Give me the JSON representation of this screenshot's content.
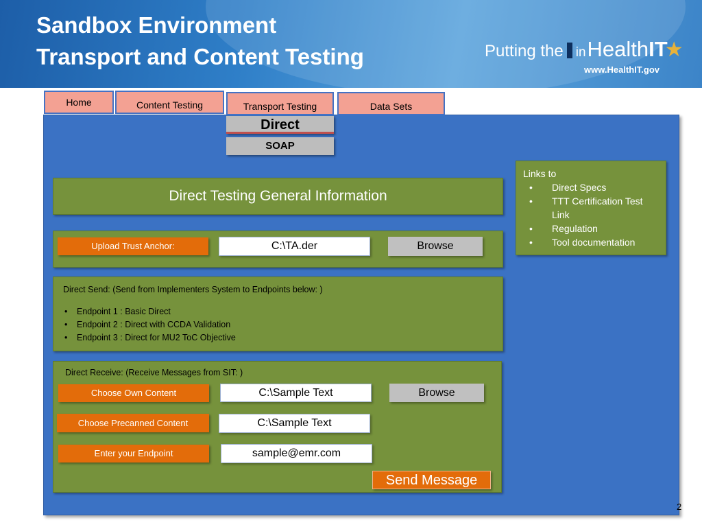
{
  "header": {
    "title_line1": "Sandbox Environment",
    "title_line2": "Transport and Content Testing",
    "logo": {
      "text_putting": "Putting the",
      "text_in": "in",
      "text_health": "Health",
      "text_it": "IT",
      "url": "www.HealthIT.gov"
    }
  },
  "tabs": [
    {
      "label": "Home"
    },
    {
      "label": "Content Testing"
    },
    {
      "label": "Transport Testing"
    },
    {
      "label": "Data Sets"
    }
  ],
  "submenu": {
    "direct": "Direct",
    "soap": "SOAP"
  },
  "general_info": {
    "title": "Direct Testing General Information"
  },
  "links": {
    "heading": "Links to",
    "items": [
      "Direct Specs",
      "TTT Certification Test Link",
      "Regulation",
      "Tool documentation"
    ]
  },
  "trust_anchor": {
    "label": "Upload Trust Anchor:",
    "value": "C:\\TA.der",
    "browse": "Browse"
  },
  "direct_send": {
    "heading": "Direct Send: (Send from Implementers System to Endpoints below: )",
    "endpoints": [
      "Endpoint 1 : Basic Direct",
      "Endpoint 2 : Direct with CCDA Validation",
      "Endpoint 3 : Direct for MU2 ToC Objective"
    ]
  },
  "direct_receive": {
    "heading": "Direct Receive: (Receive Messages from SIT: )",
    "own_content_label": "Choose Own Content",
    "own_content_value": "C:\\Sample Text",
    "browse": "Browse",
    "precanned_label": "Choose Precanned Content",
    "precanned_value": "C:\\Sample Text",
    "endpoint_label": "Enter your Endpoint",
    "endpoint_value": "sample@emr.com",
    "send_button": "Send Message"
  },
  "page_number": "2",
  "colors": {
    "panel": "#3b72c4",
    "green": "#76923c",
    "orange": "#e36c0a",
    "tab": "#f3a193",
    "gray": "#c0c0c0"
  }
}
